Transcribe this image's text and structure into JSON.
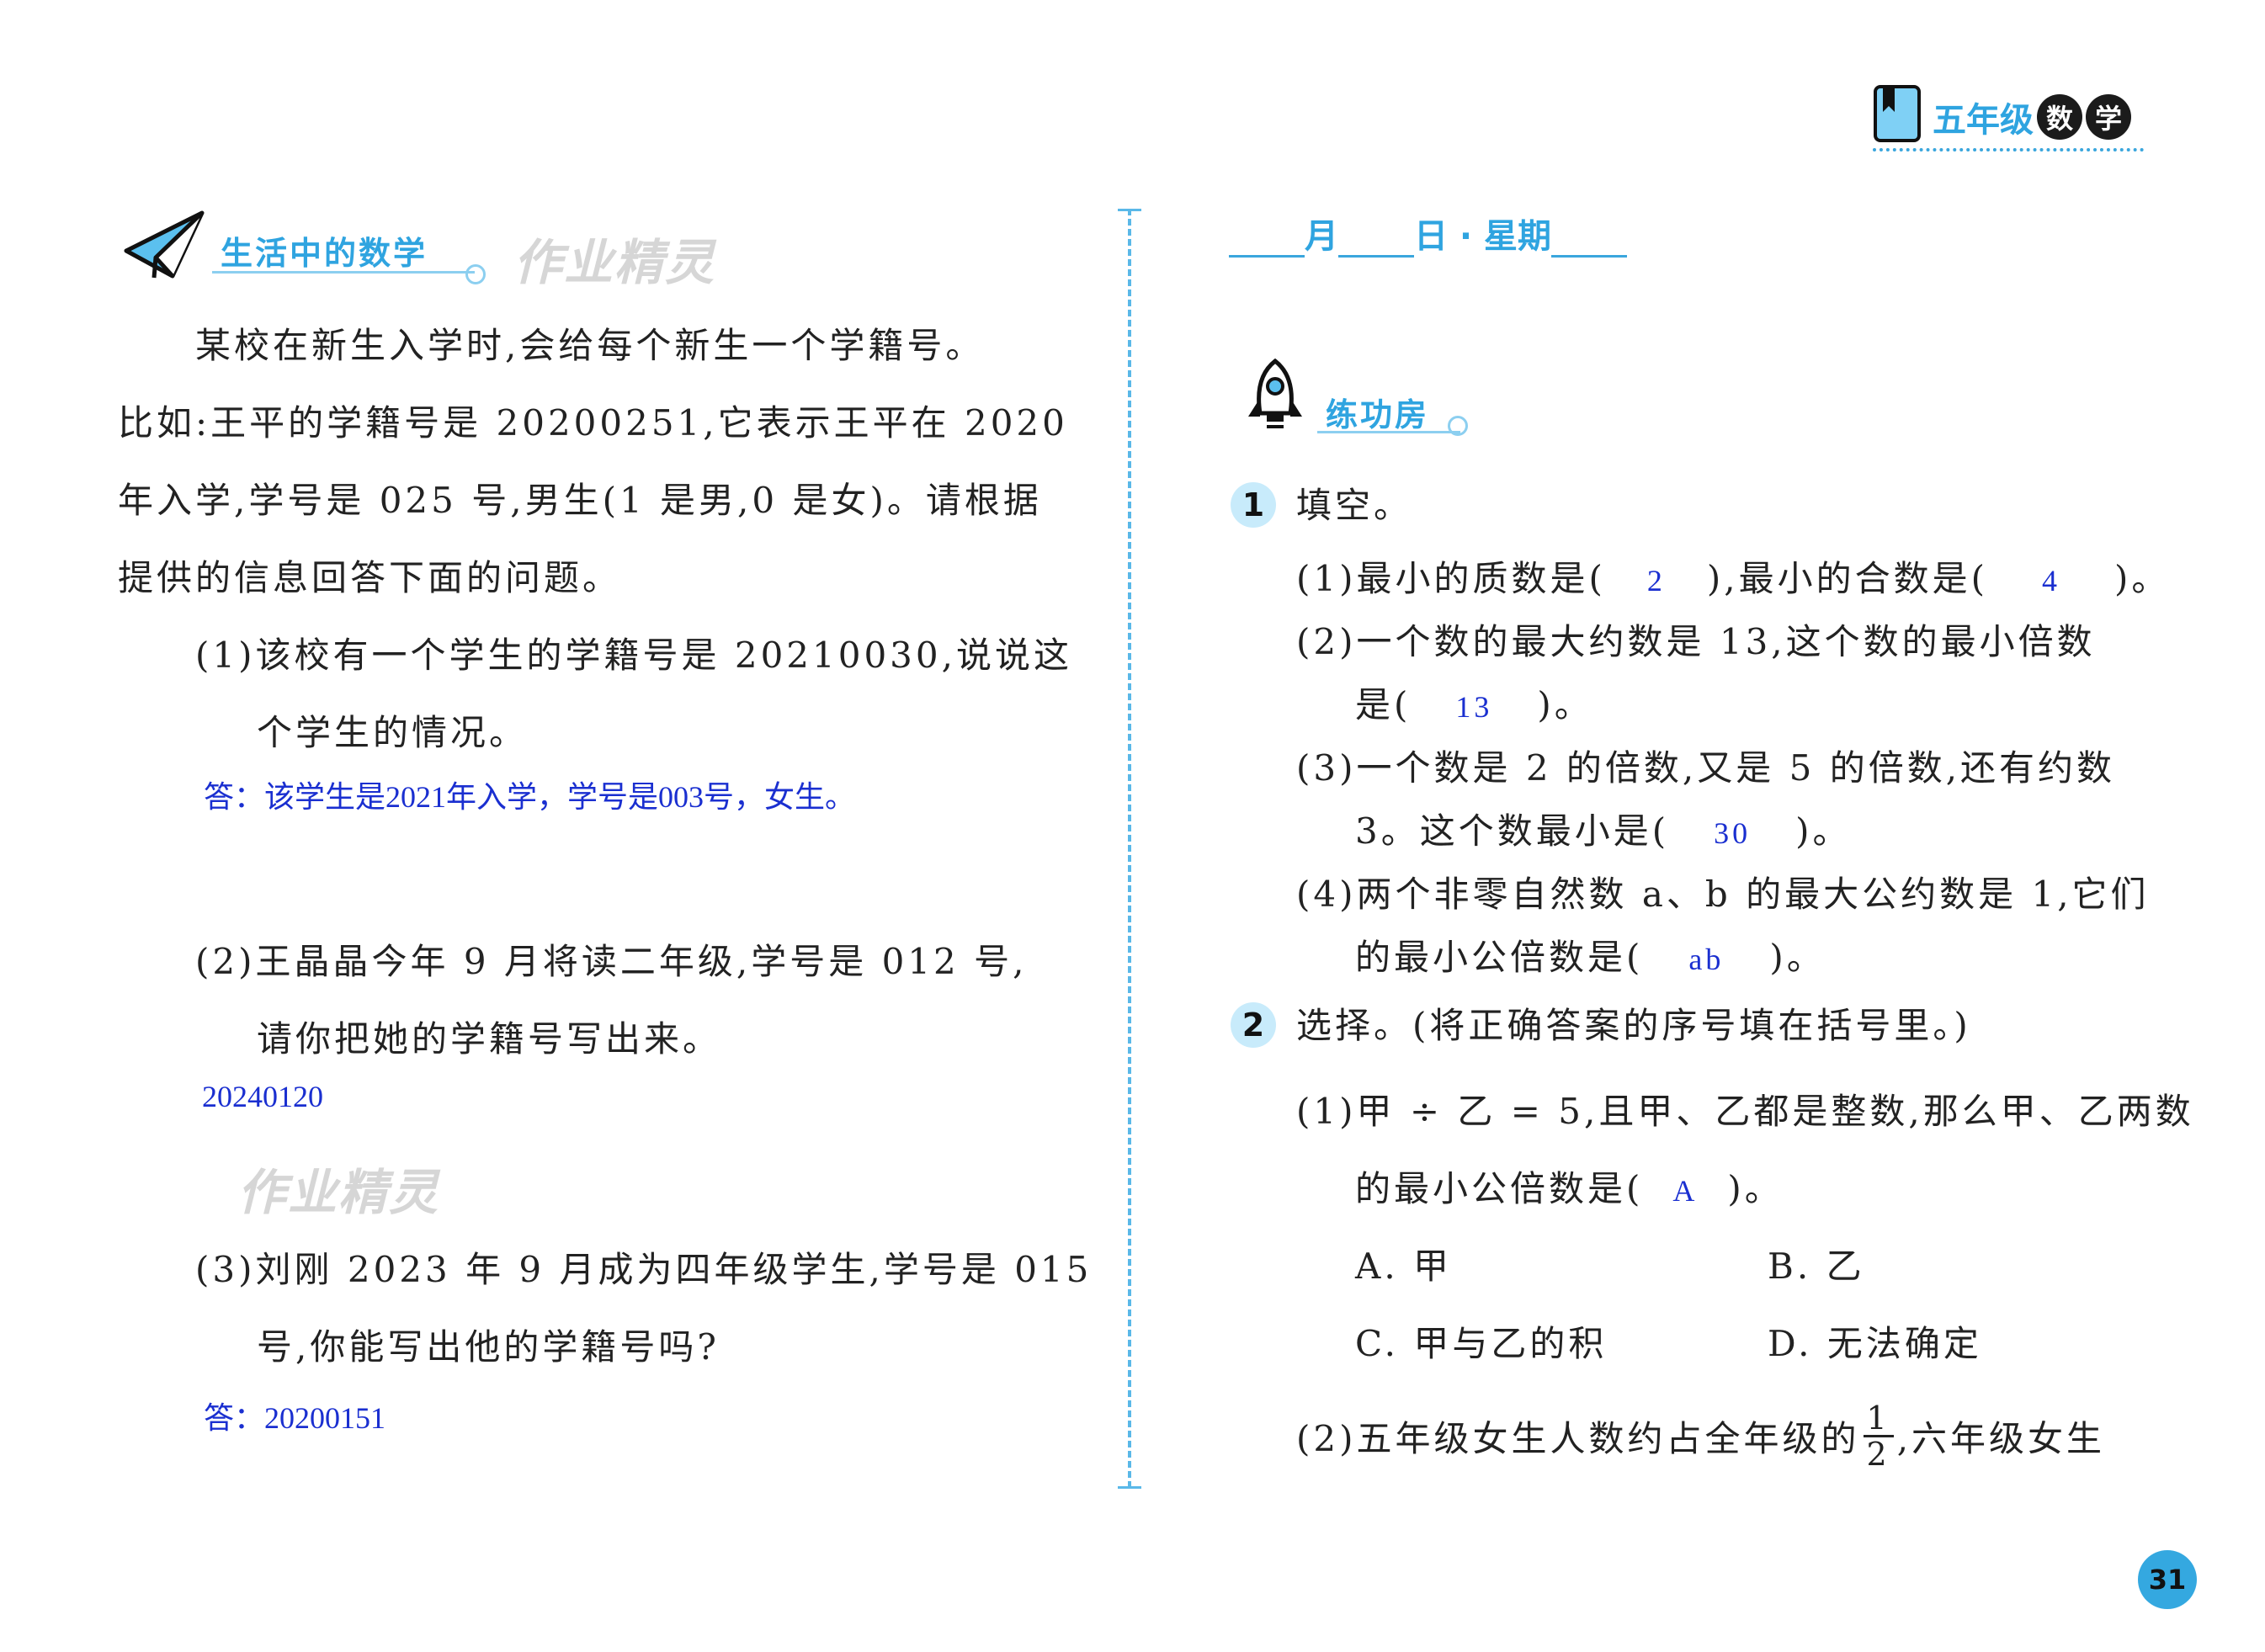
{
  "header": {
    "grade_label": "五年级",
    "subject_char_1": "数",
    "subject_char_2": "学"
  },
  "left": {
    "section_title": "生活中的数学",
    "watermark": "作业精灵",
    "intro_lines": [
      "某校在新生入学时,会给每个新生一个学籍号。",
      "比如:王平的学籍号是 20200251,它表示王平在 2020",
      "年入学,学号是 025 号,男生(1 是男,0 是女)。请根据",
      "提供的信息回答下面的问题。"
    ],
    "q1_lines": [
      "(1)该校有一个学生的学籍号是 20210030,说说这",
      "个学生的情况。"
    ],
    "q1_answer": "答：该学生是2021年入学，学号是003号，女生。",
    "q2_lines": [
      "(2)王晶晶今年 9 月将读二年级,学号是 012 号,",
      "请你把她的学籍号写出来。"
    ],
    "q2_answer": "20240120",
    "q3_lines": [
      "(3)刘刚 2023 年 9 月成为四年级学生,学号是 015",
      "号,你能写出他的学籍号吗?"
    ],
    "q3_answer": "答：20200151"
  },
  "right": {
    "date": {
      "month": "月",
      "day": "日 · 星期"
    },
    "section_title": "练功房",
    "p1": {
      "num": "1",
      "title": "填空。",
      "q1": {
        "a": "(1)最小的质数是(",
        "ans1": "2",
        "b": "),最小的合数是(",
        "ans2": "4",
        "c": ")。"
      },
      "q2": {
        "line1": "(2)一个数的最大约数是 13,这个数的最小倍数",
        "a": "是(",
        "ans": "13",
        "b": ")。"
      },
      "q3": {
        "line1": "(3)一个数是 2 的倍数,又是 5 的倍数,还有约数",
        "a": "3。这个数最小是(",
        "ans": "30",
        "b": ")。"
      },
      "q4": {
        "line1": "(4)两个非零自然数 a、b 的最大公约数是 1,它们",
        "a": "的最小公倍数是(",
        "ans": "ab",
        "b": ")。"
      }
    },
    "p2": {
      "num": "2",
      "title": "选择。(将正确答案的序号填在括号里。)",
      "q1": {
        "line1": "(1)甲 ÷ 乙 = 5,且甲、乙都是整数,那么甲、乙两数",
        "a": "的最小公倍数是(",
        "ans": "A",
        "b": ")。",
        "options": [
          "A. 甲",
          "B. 乙",
          "C. 甲与乙的积",
          "D. 无法确定"
        ]
      },
      "q2": {
        "a": "(2)五年级女生人数约占全年级的",
        "frac_num": "1",
        "frac_den": "2",
        "b": ",六年级女生"
      }
    }
  },
  "page_number": "31"
}
